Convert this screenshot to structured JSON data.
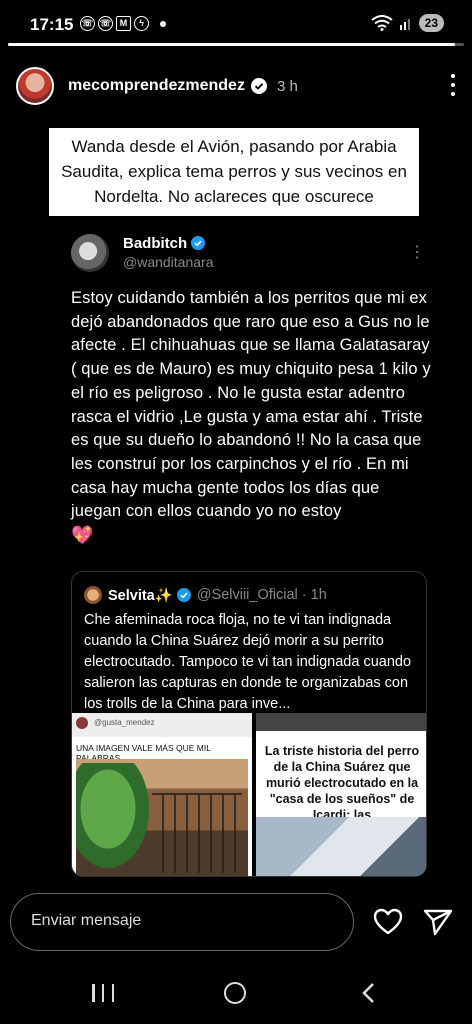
{
  "status_bar": {
    "time": "17:15",
    "battery": "23"
  },
  "story": {
    "progress": 0.98,
    "username": "mecomprendezmendez",
    "time_ago": "3 h",
    "caption": "Wanda desde el Avión, pasando por Arabia Saudita, explica tema perros y sus vecinos en Nordelta. No aclareces que oscurece"
  },
  "tweet": {
    "name": "Badbitch",
    "handle": "@wanditanara",
    "text": "Estoy cuidando también a los perritos que mi ex dejó abandonados que raro que eso a Gus no le afecte . El chihuahuas que se llama Galatasaray ( que es de Mauro) es muy chiquito pesa 1 kilo y el río es peligroso . No le gusta estar adentro rasca el vidrio ,Le gusta y ama estar ahí . Triste es que su dueño lo abandonó !! No la casa que les construí por los carpinchos y el río . En mi casa hay mucha gente todos los días que juegan con ellos cuando yo no estoy",
    "emoji": "💖"
  },
  "quote": {
    "name": "Selvita✨",
    "handle": "@Selviii_Oficial · 1h",
    "text": "Che afeminada roca floja, no te vi tan indignada cuando la China Suárez dejó morir a su perrito electrocutado. Tampoco te vi tan indignada cuando salieron las capturas en donde te organizabas con los trolls de la China para inve...",
    "image_left": {
      "handle": "@gusta_mendez",
      "title": "UNA IMAGEN VALE MÁS QUE MIL PALABRAS"
    },
    "image_right": {
      "headline": "La triste historia del perro de la China Suárez que murió electrocutado en la \"casa de los sueños\" de Icardi: las"
    }
  },
  "reply": {
    "placeholder": "Enviar mensaje"
  },
  "colors": {
    "background": "#000000",
    "verified": "#1d9bf0"
  }
}
